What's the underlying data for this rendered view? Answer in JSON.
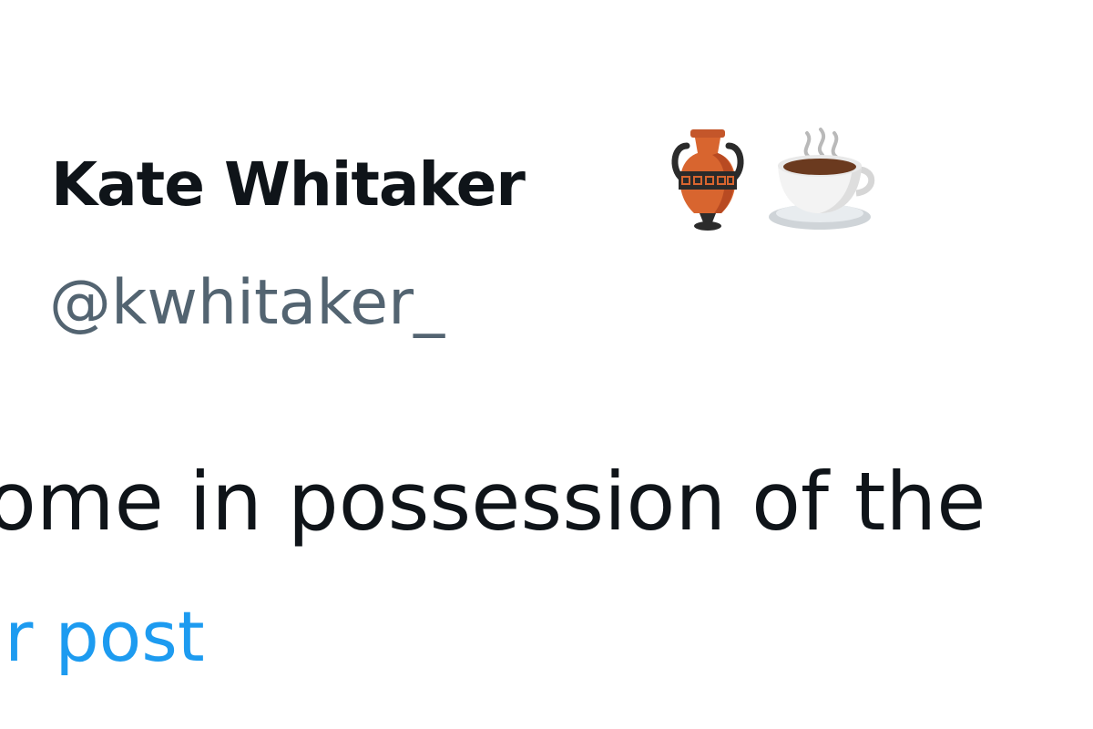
{
  "tweet": {
    "author": {
      "display_name": "Kate Whitaker",
      "handle": "@kwhitaker_",
      "name_emojis": [
        "amphora-icon",
        "hot-beverage-icon"
      ]
    },
    "text": "ome in possession of the",
    "link_text": "ir post"
  },
  "colors": {
    "name_text": "#0f1419",
    "handle_text": "#536471",
    "body_text": "#0f1419",
    "link": "#1d9bf0",
    "background": "#ffffff"
  }
}
